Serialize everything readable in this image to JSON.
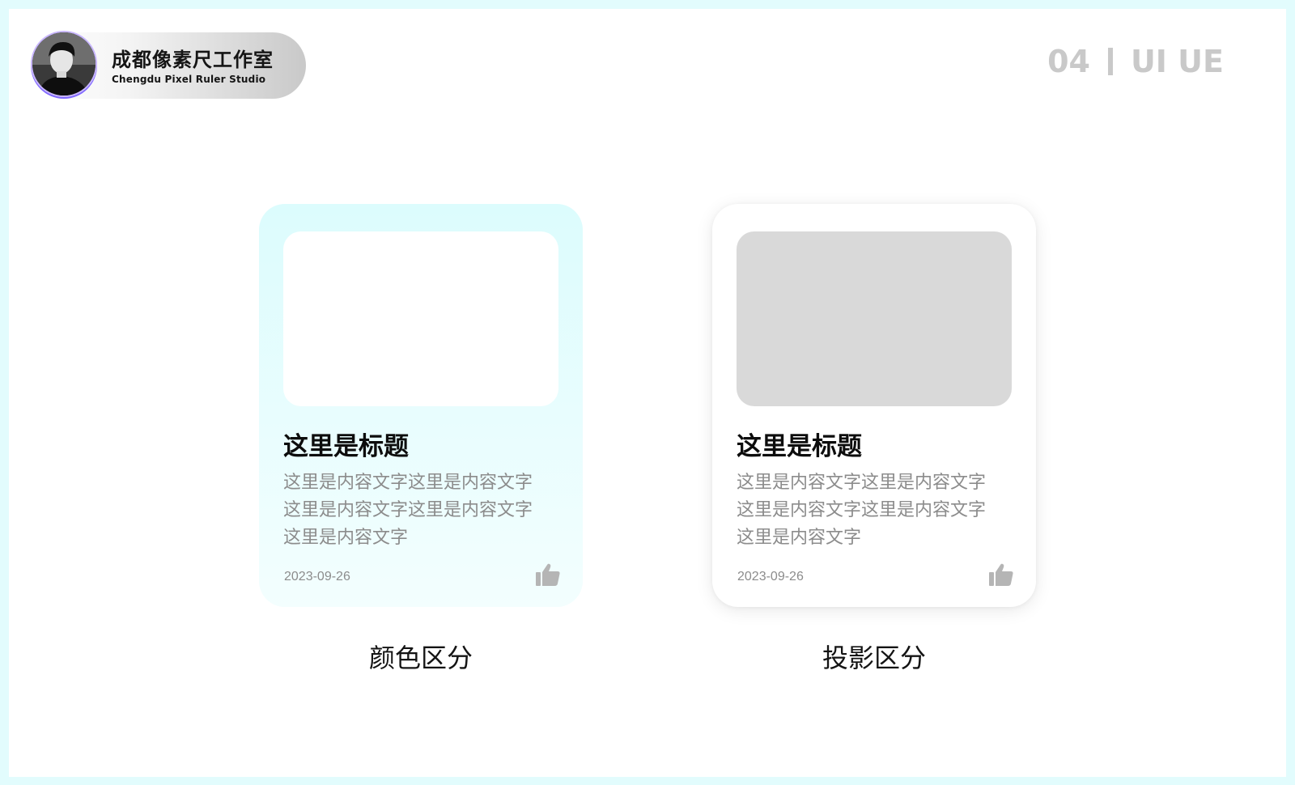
{
  "header": {
    "studio_name": "成都像素尺工作室",
    "studio_name_en": "Chengdu Pixel Ruler Studio",
    "avatar_icon": "avatar-photo",
    "page_number": "04",
    "page_section": "UI UE"
  },
  "cards": [
    {
      "variant": "color-distinction",
      "title": "这里是标题",
      "body_lines": [
        "这里是内容文字这里是内容文字",
        "这里是内容文字这里是内容文字",
        "这里是内容文字"
      ],
      "date": "2023-09-26",
      "like_icon": "thumbs-up-icon",
      "caption": "颜色区分"
    },
    {
      "variant": "shadow-distinction",
      "title": "这里是标题",
      "body_lines": [
        "这里是内容文字这里是内容文字",
        "这里是内容文字这里是内容文字",
        "这里是内容文字"
      ],
      "date": "2023-09-26",
      "like_icon": "thumbs-up-icon",
      "caption": "投影区分"
    }
  ],
  "colors": {
    "page_border": "#e2fcfd",
    "card_color_top": "#dcfcfd",
    "card_image_placeholder": "#d9d9d9",
    "muted_text": "#8c8c8c",
    "page_indicator": "#c9c9c9"
  }
}
